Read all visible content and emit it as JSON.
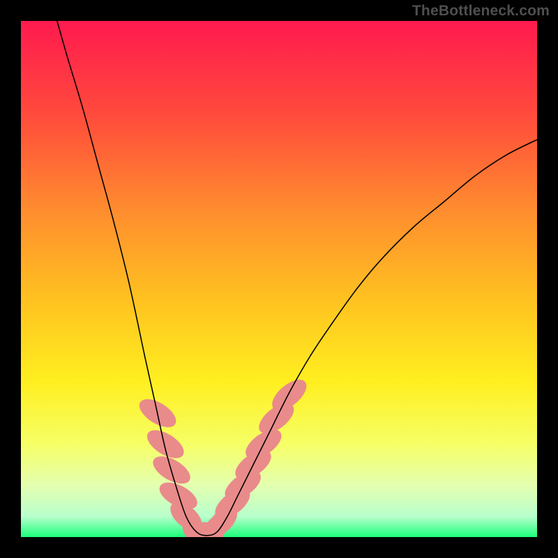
{
  "watermark": "TheBottleneck.com",
  "chart_data": {
    "type": "line",
    "title": "",
    "xlabel": "",
    "ylabel": "",
    "xlim": [
      0,
      100
    ],
    "ylim": [
      0,
      100
    ],
    "grid": false,
    "legend": false,
    "background_gradient": {
      "stops": [
        {
          "offset": 0.0,
          "color": "#ff1a4f"
        },
        {
          "offset": 0.18,
          "color": "#ff4a3c"
        },
        {
          "offset": 0.36,
          "color": "#ff8a2f"
        },
        {
          "offset": 0.54,
          "color": "#ffc220"
        },
        {
          "offset": 0.7,
          "color": "#ffef20"
        },
        {
          "offset": 0.82,
          "color": "#f6ff66"
        },
        {
          "offset": 0.9,
          "color": "#e4ffb0"
        },
        {
          "offset": 0.96,
          "color": "#b8ffcc"
        },
        {
          "offset": 1.0,
          "color": "#1bff7a"
        }
      ]
    },
    "series": [
      {
        "name": "bottleneck-curve",
        "color": "#000000",
        "width": 1.6,
        "points": [
          {
            "x": 7,
            "y": 100
          },
          {
            "x": 9,
            "y": 93
          },
          {
            "x": 12,
            "y": 83
          },
          {
            "x": 15,
            "y": 72
          },
          {
            "x": 18,
            "y": 61
          },
          {
            "x": 21,
            "y": 49
          },
          {
            "x": 24,
            "y": 35
          },
          {
            "x": 26,
            "y": 26
          },
          {
            "x": 28,
            "y": 17
          },
          {
            "x": 30,
            "y": 10
          },
          {
            "x": 32,
            "y": 4
          },
          {
            "x": 34,
            "y": 1
          },
          {
            "x": 36,
            "y": 0.3
          },
          {
            "x": 38,
            "y": 1
          },
          {
            "x": 40,
            "y": 4
          },
          {
            "x": 42,
            "y": 8
          },
          {
            "x": 45,
            "y": 14
          },
          {
            "x": 48,
            "y": 20
          },
          {
            "x": 52,
            "y": 28
          },
          {
            "x": 56,
            "y": 35
          },
          {
            "x": 60,
            "y": 41
          },
          {
            "x": 65,
            "y": 48
          },
          {
            "x": 70,
            "y": 54
          },
          {
            "x": 76,
            "y": 60
          },
          {
            "x": 82,
            "y": 65
          },
          {
            "x": 88,
            "y": 70
          },
          {
            "x": 94,
            "y": 74
          },
          {
            "x": 100,
            "y": 77
          }
        ]
      }
    ],
    "markers": {
      "name": "highlight-band",
      "color": "#e98b8b",
      "points": [
        {
          "x": 26.5,
          "y": 24,
          "rx": 2.0,
          "ry": 4.0,
          "rot": -58
        },
        {
          "x": 28.0,
          "y": 18,
          "rx": 2.0,
          "ry": 4.0,
          "rot": -58
        },
        {
          "x": 29.2,
          "y": 13,
          "rx": 2.0,
          "ry": 4.0,
          "rot": -60
        },
        {
          "x": 30.5,
          "y": 8,
          "rx": 2.0,
          "ry": 4.0,
          "rot": -62
        },
        {
          "x": 32.0,
          "y": 4,
          "rx": 2.0,
          "ry": 3.6,
          "rot": -50
        },
        {
          "x": 33.5,
          "y": 1.4,
          "rx": 2.0,
          "ry": 3.2,
          "rot": -25
        },
        {
          "x": 35.5,
          "y": 0.5,
          "rx": 2.8,
          "ry": 2.4,
          "rot": 0
        },
        {
          "x": 37.5,
          "y": 1.2,
          "rx": 2.0,
          "ry": 3.2,
          "rot": 25
        },
        {
          "x": 39.0,
          "y": 3,
          "rx": 2.0,
          "ry": 3.6,
          "rot": 45
        },
        {
          "x": 41.0,
          "y": 6.5,
          "rx": 2.0,
          "ry": 4.0,
          "rot": 52
        },
        {
          "x": 43.0,
          "y": 10,
          "rx": 2.0,
          "ry": 4.0,
          "rot": 55
        },
        {
          "x": 45.0,
          "y": 14,
          "rx": 2.0,
          "ry": 4.0,
          "rot": 55
        },
        {
          "x": 47.0,
          "y": 18,
          "rx": 2.0,
          "ry": 4.0,
          "rot": 55
        },
        {
          "x": 49.5,
          "y": 23,
          "rx": 2.0,
          "ry": 4.0,
          "rot": 52
        },
        {
          "x": 52.0,
          "y": 27.5,
          "rx": 2.0,
          "ry": 4.0,
          "rot": 50
        }
      ]
    }
  }
}
